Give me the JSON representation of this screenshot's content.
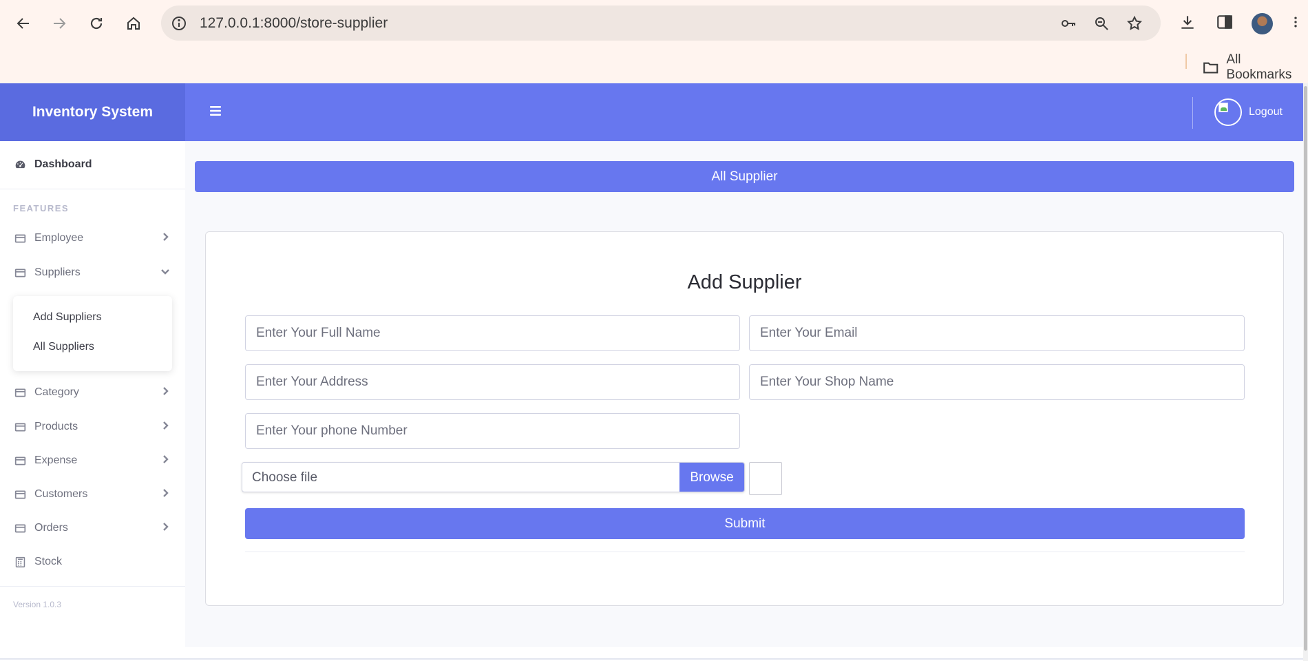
{
  "browser": {
    "url": "127.0.0.1:8000/store-supplier",
    "bookmarks_label": "All Bookmarks"
  },
  "app": {
    "brand": "Inventory System",
    "logout_label": "Logout",
    "accent_color": "#6777ef"
  },
  "sidebar": {
    "dashboard": "Dashboard",
    "heading": "FEATURES",
    "items": [
      {
        "label": "Employee",
        "expanded": false
      },
      {
        "label": "Suppliers",
        "expanded": true
      },
      {
        "label": "Category",
        "expanded": false
      },
      {
        "label": "Products",
        "expanded": false
      },
      {
        "label": "Expense",
        "expanded": false
      },
      {
        "label": "Customers",
        "expanded": false
      },
      {
        "label": "Orders",
        "expanded": false
      }
    ],
    "suppliers_submenu": [
      "Add Suppliers",
      "All Suppliers"
    ],
    "stock": "Stock",
    "version": "Version 1.0.3"
  },
  "main": {
    "title_bar": "All Supplier",
    "form": {
      "title": "Add Supplier",
      "full_name_placeholder": "Enter Your Full Name",
      "email_placeholder": "Enter Your Email",
      "address_placeholder": "Enter Your Address",
      "shop_name_placeholder": "Enter Your Shop Name",
      "phone_placeholder": "Enter Your phone Number",
      "file_label": "Choose file",
      "browse_label": "Browse",
      "submit_label": "Submit"
    }
  }
}
